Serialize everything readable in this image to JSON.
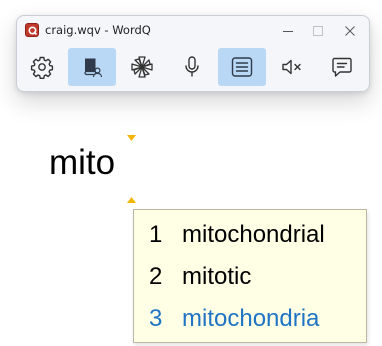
{
  "window": {
    "title": "craig.wqv - WordQ"
  },
  "toolbar": {
    "buttons": [
      {
        "name": "settings-button",
        "icon": "gear-icon",
        "active": false
      },
      {
        "name": "reading-user-button",
        "icon": "book-user-icon",
        "active": true
      },
      {
        "name": "topic-button",
        "icon": "asterisk-icon",
        "active": false
      },
      {
        "name": "microphone-button",
        "icon": "microphone-icon",
        "active": false
      },
      {
        "name": "prediction-list-button",
        "icon": "list-icon",
        "active": true
      },
      {
        "name": "mute-button",
        "icon": "speaker-mute-icon",
        "active": false
      },
      {
        "name": "speech-bubble-button",
        "icon": "speech-bubble-icon",
        "active": false
      }
    ]
  },
  "document": {
    "typed_word": "mito"
  },
  "predictions": [
    {
      "number": "1",
      "word": "mitochondrial",
      "highlighted": false
    },
    {
      "number": "2",
      "word": "mitotic",
      "highlighted": false
    },
    {
      "number": "3",
      "word": "mitochondria",
      "highlighted": true
    }
  ],
  "colors": {
    "active_button": "#b9d8f6",
    "prediction_background": "#ffffe6",
    "highlight_text": "#1f74c4",
    "cursor_marker": "#f2b705"
  }
}
